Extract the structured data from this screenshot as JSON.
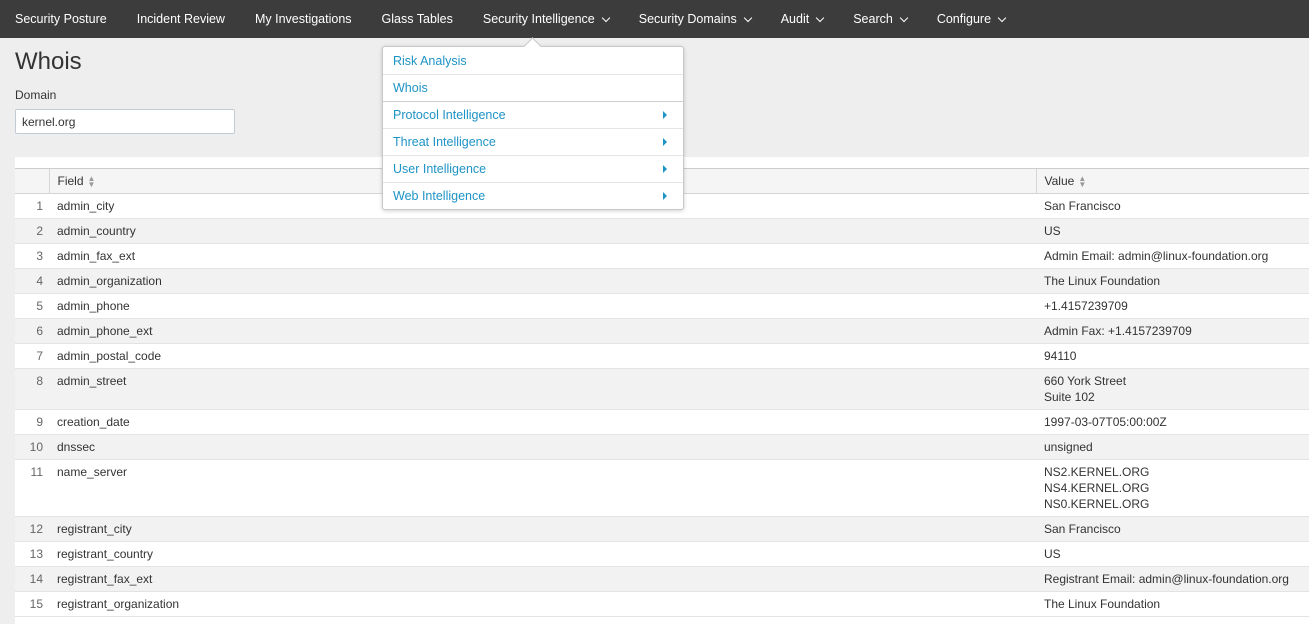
{
  "nav": {
    "items": [
      {
        "label": "Security Posture",
        "has_caret": false
      },
      {
        "label": "Incident Review",
        "has_caret": false
      },
      {
        "label": "My Investigations",
        "has_caret": false
      },
      {
        "label": "Glass Tables",
        "has_caret": false
      },
      {
        "label": "Security Intelligence",
        "has_caret": true
      },
      {
        "label": "Security Domains",
        "has_caret": true
      },
      {
        "label": "Audit",
        "has_caret": true
      },
      {
        "label": "Search",
        "has_caret": true
      },
      {
        "label": "Configure",
        "has_caret": true
      }
    ]
  },
  "page": {
    "title": "Whois",
    "domain_label": "Domain",
    "domain_value": "kernel.org"
  },
  "dropdown": {
    "items": [
      {
        "label": "Risk Analysis",
        "submenu": false
      },
      {
        "label": "Whois",
        "submenu": false
      },
      {
        "label": "Protocol Intelligence",
        "submenu": true
      },
      {
        "label": "Threat Intelligence",
        "submenu": true
      },
      {
        "label": "User Intelligence",
        "submenu": true
      },
      {
        "label": "Web Intelligence",
        "submenu": true
      }
    ]
  },
  "table": {
    "columns": {
      "field": "Field",
      "value": "Value"
    },
    "rows": [
      {
        "num": "1",
        "field": "admin_city",
        "value": [
          "San Francisco"
        ]
      },
      {
        "num": "2",
        "field": "admin_country",
        "value": [
          "US"
        ]
      },
      {
        "num": "3",
        "field": "admin_fax_ext",
        "value": [
          "Admin Email: admin@linux-foundation.org"
        ]
      },
      {
        "num": "4",
        "field": "admin_organization",
        "value": [
          "The Linux Foundation"
        ]
      },
      {
        "num": "5",
        "field": "admin_phone",
        "value": [
          "+1.4157239709"
        ]
      },
      {
        "num": "6",
        "field": "admin_phone_ext",
        "value": [
          "Admin Fax: +1.4157239709"
        ]
      },
      {
        "num": "7",
        "field": "admin_postal_code",
        "value": [
          "94110"
        ]
      },
      {
        "num": "8",
        "field": "admin_street",
        "value": [
          "660 York Street",
          "Suite 102"
        ]
      },
      {
        "num": "9",
        "field": "creation_date",
        "value": [
          "1997-03-07T05:00:00Z"
        ]
      },
      {
        "num": "10",
        "field": "dnssec",
        "value": [
          "unsigned"
        ]
      },
      {
        "num": "11",
        "field": "name_server",
        "value": [
          "NS2.KERNEL.ORG",
          "NS4.KERNEL.ORG",
          "NS0.KERNEL.ORG"
        ]
      },
      {
        "num": "12",
        "field": "registrant_city",
        "value": [
          "San Francisco"
        ]
      },
      {
        "num": "13",
        "field": "registrant_country",
        "value": [
          "US"
        ]
      },
      {
        "num": "14",
        "field": "registrant_fax_ext",
        "value": [
          "Registrant Email: admin@linux-foundation.org"
        ]
      },
      {
        "num": "15",
        "field": "registrant_organization",
        "value": [
          "The Linux Foundation"
        ]
      }
    ]
  }
}
